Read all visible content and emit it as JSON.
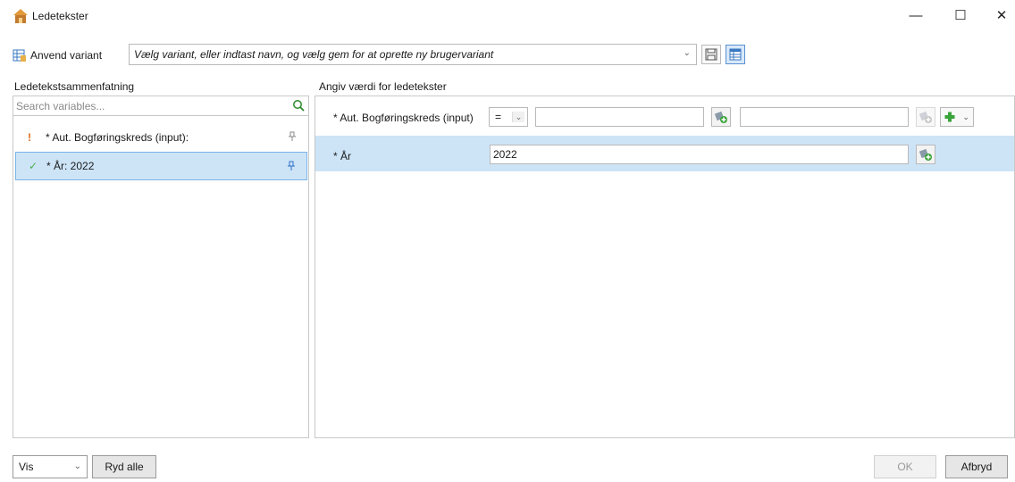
{
  "window": {
    "title": "Ledetekster",
    "minimize_glyph": "—",
    "maximize_glyph": "☐",
    "close_glyph": "✕"
  },
  "variant": {
    "apply_label": "Anvend variant",
    "combo_text": "Vælg variant, eller indtast navn, og vælg gem for at oprette ny brugervariant"
  },
  "left": {
    "header": "Ledetekstsammenfatning",
    "search_placeholder": "Search variables...",
    "items": [
      {
        "mark": "!",
        "label": "* Aut. Bogføringskreds (input):"
      },
      {
        "mark": "✓",
        "label": "* År: 2022"
      }
    ]
  },
  "right": {
    "header": "Angiv værdi for ledetekster",
    "rows": [
      {
        "label": "* Aut. Bogføringskreds (input)",
        "operator": "=",
        "value_from": "",
        "value_to": ""
      },
      {
        "label": "* År",
        "value": "2022"
      }
    ]
  },
  "bottom": {
    "vis_label": "Vis",
    "clear_label": "Ryd alle",
    "ok_label": "OK",
    "cancel_label": "Afbryd"
  },
  "icons": {
    "app": "app-icon",
    "variant": "variant-icon",
    "save": "save-icon",
    "grid": "grid-icon",
    "search": "search-icon",
    "pin": "pin-icon",
    "value_help": "value-help-icon",
    "add": "add-icon"
  },
  "colors": {
    "selection": "#cde4f7",
    "selection_border": "#7ab5e6",
    "warning": "#e06a1b",
    "ok": "#4caf50"
  }
}
